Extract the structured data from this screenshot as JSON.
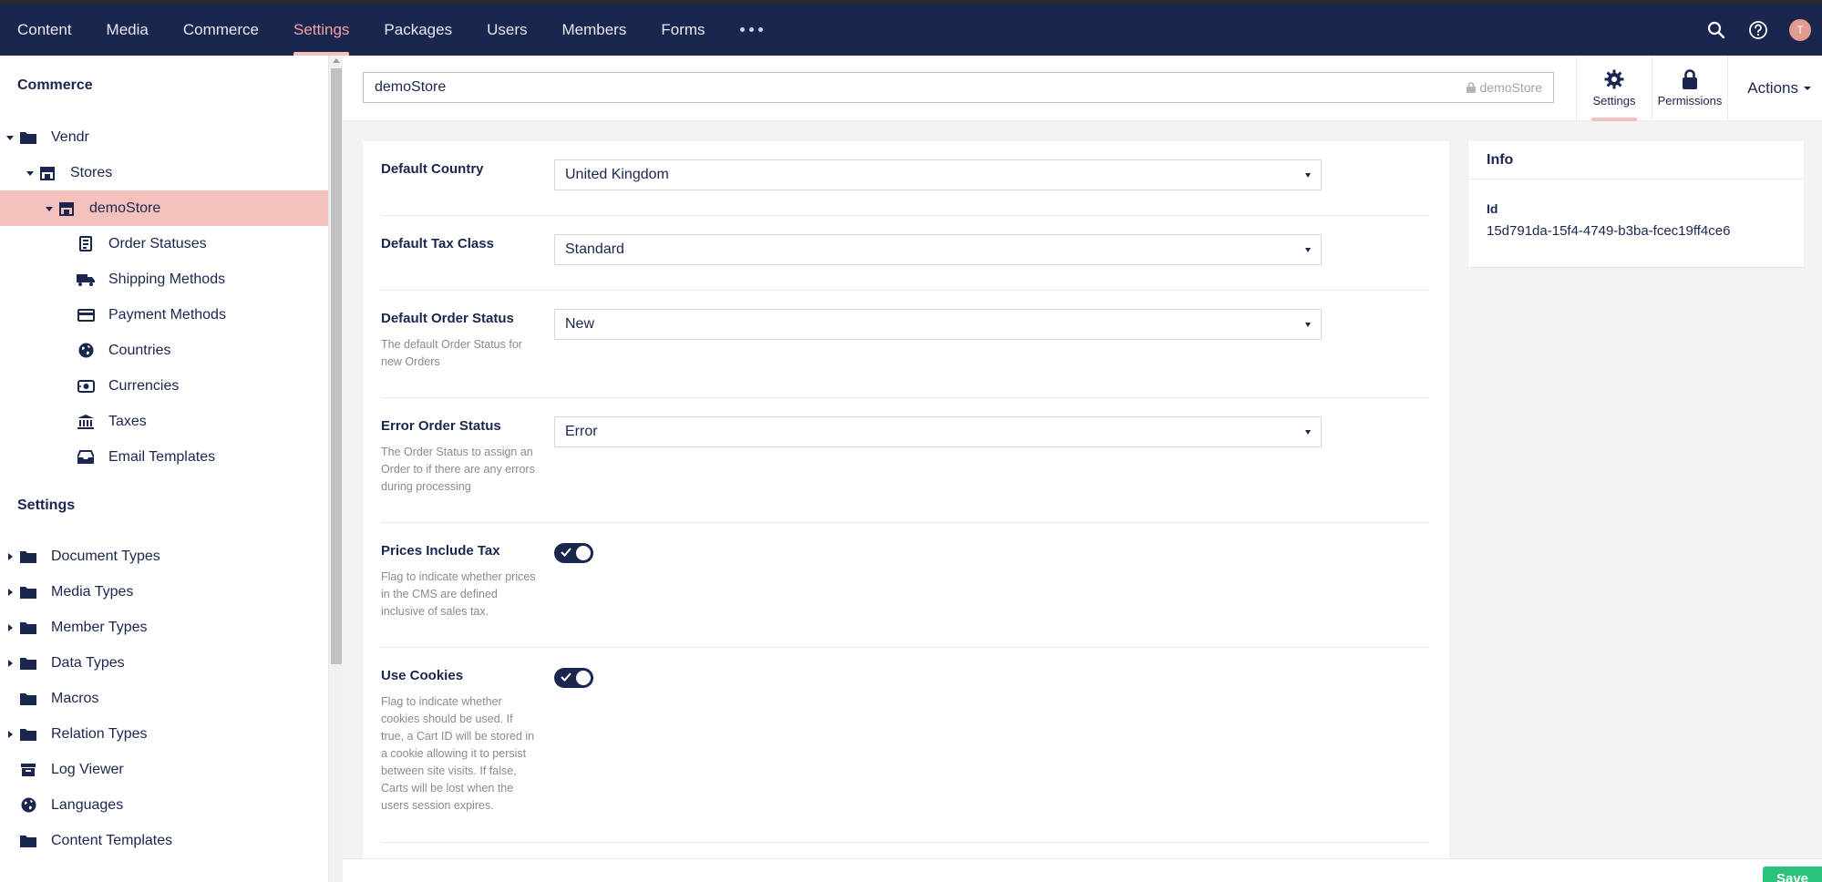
{
  "nav": {
    "items": [
      {
        "label": "Content"
      },
      {
        "label": "Media"
      },
      {
        "label": "Commerce"
      },
      {
        "label": "Settings",
        "active": true
      },
      {
        "label": "Packages"
      },
      {
        "label": "Users"
      },
      {
        "label": "Members"
      },
      {
        "label": "Forms"
      }
    ],
    "more_icon": "ellipsis-icon",
    "search_icon": "search-icon",
    "help_icon": "help-icon",
    "avatar_initial": "T"
  },
  "sidebar": {
    "commerce_title": "Commerce",
    "commerce_tree": [
      {
        "label": "Vendr",
        "icon": "folder-icon",
        "level": 0,
        "expanded": true
      },
      {
        "label": "Stores",
        "icon": "store-icon",
        "level": 1,
        "expanded": true
      },
      {
        "label": "demoStore",
        "icon": "store-icon",
        "level": 2,
        "expanded": true,
        "selected": true
      },
      {
        "label": "Order Statuses",
        "icon": "order-status-icon",
        "level": 3
      },
      {
        "label": "Shipping Methods",
        "icon": "truck-icon",
        "level": 3
      },
      {
        "label": "Payment Methods",
        "icon": "credit-card-icon",
        "level": 3
      },
      {
        "label": "Countries",
        "icon": "globe-icon",
        "level": 3
      },
      {
        "label": "Currencies",
        "icon": "currency-icon",
        "level": 3
      },
      {
        "label": "Taxes",
        "icon": "bank-icon",
        "level": 3
      },
      {
        "label": "Email Templates",
        "icon": "inbox-icon",
        "level": 3
      }
    ],
    "settings_title": "Settings",
    "settings_tree": [
      {
        "label": "Document Types",
        "icon": "folder-icon",
        "collapsed": true
      },
      {
        "label": "Media Types",
        "icon": "folder-icon",
        "collapsed": true
      },
      {
        "label": "Member Types",
        "icon": "folder-icon",
        "collapsed": true
      },
      {
        "label": "Data Types",
        "icon": "folder-icon",
        "collapsed": true
      },
      {
        "label": "Macros",
        "icon": "folder-icon"
      },
      {
        "label": "Relation Types",
        "icon": "folder-icon",
        "collapsed": true
      },
      {
        "label": "Log Viewer",
        "icon": "box-icon"
      },
      {
        "label": "Languages",
        "icon": "globe-icon"
      },
      {
        "label": "Content Templates",
        "icon": "folder-icon"
      }
    ]
  },
  "header": {
    "name_value": "demoStore",
    "alias": "demoStore",
    "tabs": [
      {
        "label": "Settings",
        "icon": "gear-icon",
        "active": true
      },
      {
        "label": "Permissions",
        "icon": "lock-icon"
      }
    ],
    "actions_label": "Actions"
  },
  "properties": [
    {
      "label": "Default Country",
      "type": "select",
      "value": "United Kingdom"
    },
    {
      "label": "Default Tax Class",
      "type": "select",
      "value": "Standard"
    },
    {
      "label": "Default Order Status",
      "desc": "The default Order Status for new Orders",
      "type": "select",
      "value": "New"
    },
    {
      "label": "Error Order Status",
      "desc": "The Order Status to assign an Order to if there are any errors during processing",
      "type": "select",
      "value": "Error"
    },
    {
      "label": "Prices Include Tax",
      "desc": "Flag to indicate whether prices in the CMS are defined inclusive of sales tax.",
      "type": "toggle",
      "value": true
    },
    {
      "label": "Use Cookies",
      "desc": "Flag to indicate whether cookies should be used. If true, a Cart ID will be stored in a cookie allowing it to persist between site visits. If false, Carts will be lost when the users session expires.",
      "type": "toggle",
      "value": true
    }
  ],
  "info": {
    "title": "Info",
    "id_label": "Id",
    "id_value": "15d791da-15f4-4749-b3ba-fcec19ff4ce6"
  },
  "footer": {
    "save_label": "Save"
  },
  "colors": {
    "nav_bg": "#1b264f",
    "active_accent": "#f5c1bc",
    "save_green": "#2bc37c"
  }
}
